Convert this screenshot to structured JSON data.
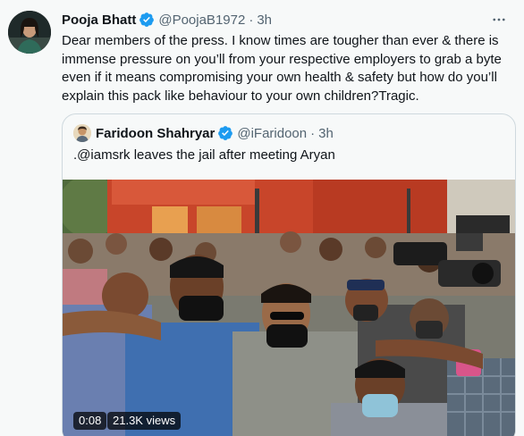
{
  "tweet": {
    "author_name": "Pooja Bhatt",
    "handle": "@PoojaB1972",
    "separator": "·",
    "time": "3h",
    "text": "Dear members of the press. I know times are tougher than ever & there is immense pressure on you’ll from your respective employers to grab a byte even if it means compromising your own health & safety but how do you’ll explain this pack like behaviour to your own children?Tragic."
  },
  "quoted_tweet": {
    "author_name": "Faridoon Shahryar",
    "handle": "@iFaridoon",
    "separator": "·",
    "time": "3h",
    "text": ".@iamsrk leaves the jail after meeting Aryan",
    "video": {
      "duration": "0:08",
      "views": "21.3K views"
    }
  },
  "icons": {
    "verified": "verified-badge-icon",
    "more": "more-options-icon"
  },
  "colors": {
    "background": "#f7f9f9",
    "text_primary": "#0f1419",
    "text_secondary": "#536471",
    "verified_blue": "#1d9bf0",
    "border": "#cfd9de"
  }
}
